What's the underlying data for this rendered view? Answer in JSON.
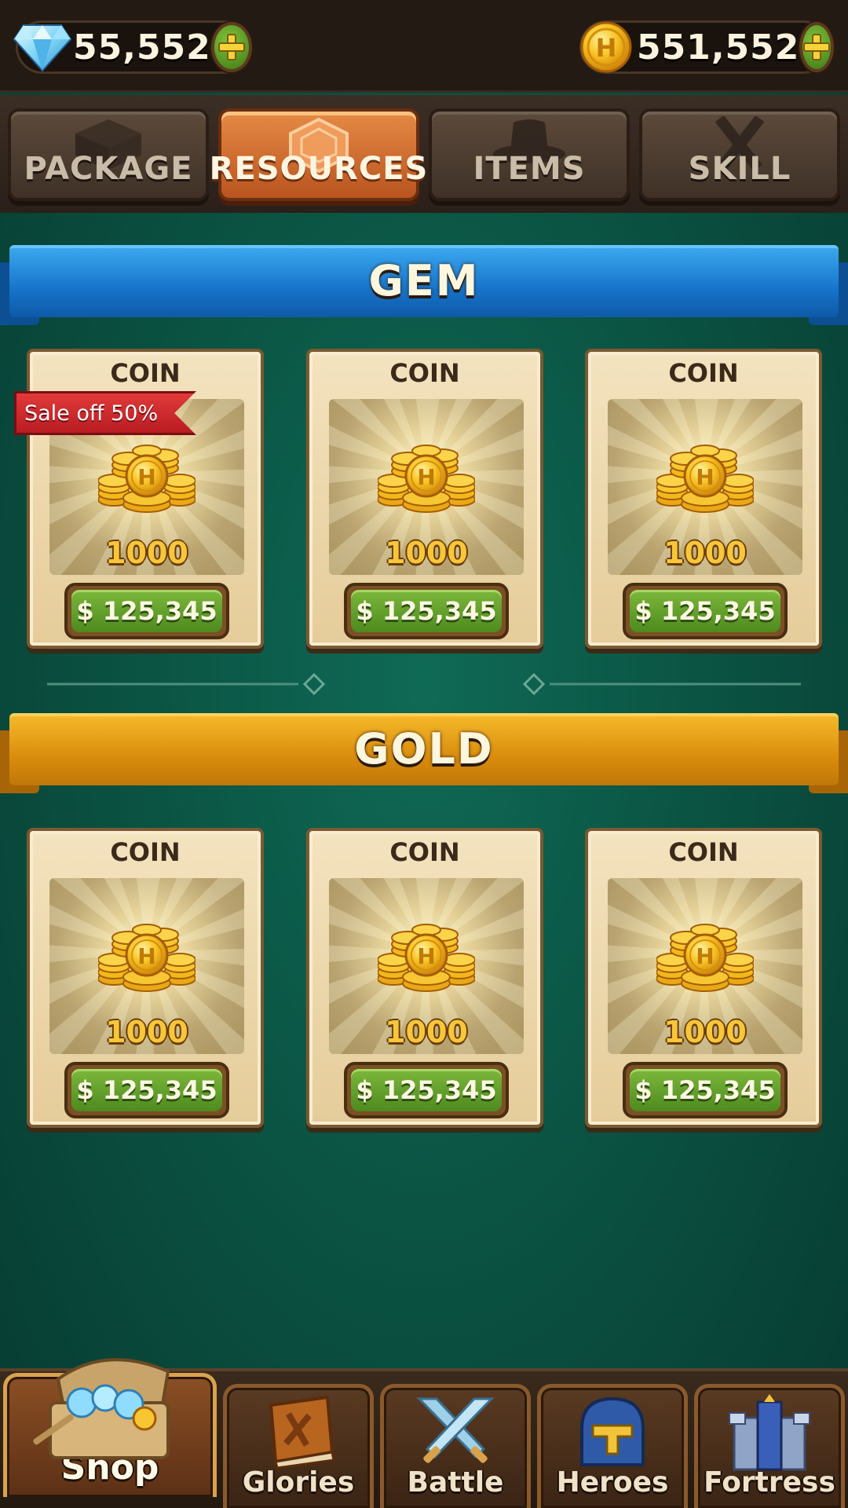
{
  "currencies": {
    "gem": {
      "icon": "diamond-icon",
      "amount": "55,552",
      "plus_icon": "plus-icon"
    },
    "coin": {
      "icon": "h-coin-icon",
      "letter": "H",
      "amount": "551,552",
      "plus_icon": "plus-icon"
    }
  },
  "tabs": [
    {
      "label": "PACKAGE",
      "icon": "box-icon",
      "active": false
    },
    {
      "label": "RESOURCES",
      "icon": "gem-outline-icon",
      "active": true
    },
    {
      "label": "ITEMS",
      "icon": "hat-icon",
      "active": false
    },
    {
      "label": "SKILL",
      "icon": "crossed-swords-icon",
      "active": false
    }
  ],
  "sections": {
    "gem": {
      "title": "GEM",
      "sale_tag": "Sale off 50%",
      "cards": [
        {
          "title": "COIN",
          "amount": "1000",
          "price": "$ 125,345"
        },
        {
          "title": "COIN",
          "amount": "1000",
          "price": "$ 125,345"
        },
        {
          "title": "COIN",
          "amount": "1000",
          "price": "$ 125,345"
        }
      ]
    },
    "gold": {
      "title": "GOLD",
      "cards": [
        {
          "title": "COIN",
          "amount": "1000",
          "price": "$ 125,345"
        },
        {
          "title": "COIN",
          "amount": "1000",
          "price": "$ 125,345"
        },
        {
          "title": "COIN",
          "amount": "1000",
          "price": "$ 125,345"
        }
      ]
    }
  },
  "bottom_nav": [
    {
      "label": "Shop",
      "icon": "treasure-chest-icon",
      "active": true
    },
    {
      "label": "Glories",
      "icon": "book-icon",
      "active": false
    },
    {
      "label": "Battle",
      "icon": "crossed-swords-icon",
      "active": false
    },
    {
      "label": "Heroes",
      "icon": "knight-helmet-icon",
      "active": false
    },
    {
      "label": "Fortress",
      "icon": "tower-icon",
      "active": false
    }
  ],
  "colors": {
    "background": "#0b5444",
    "gem_banner": "#1673c9",
    "gold_banner": "#d98c0c",
    "active_tab": "#c96528",
    "price_button": "#5a9a26",
    "sale_tag": "#c8232a"
  }
}
